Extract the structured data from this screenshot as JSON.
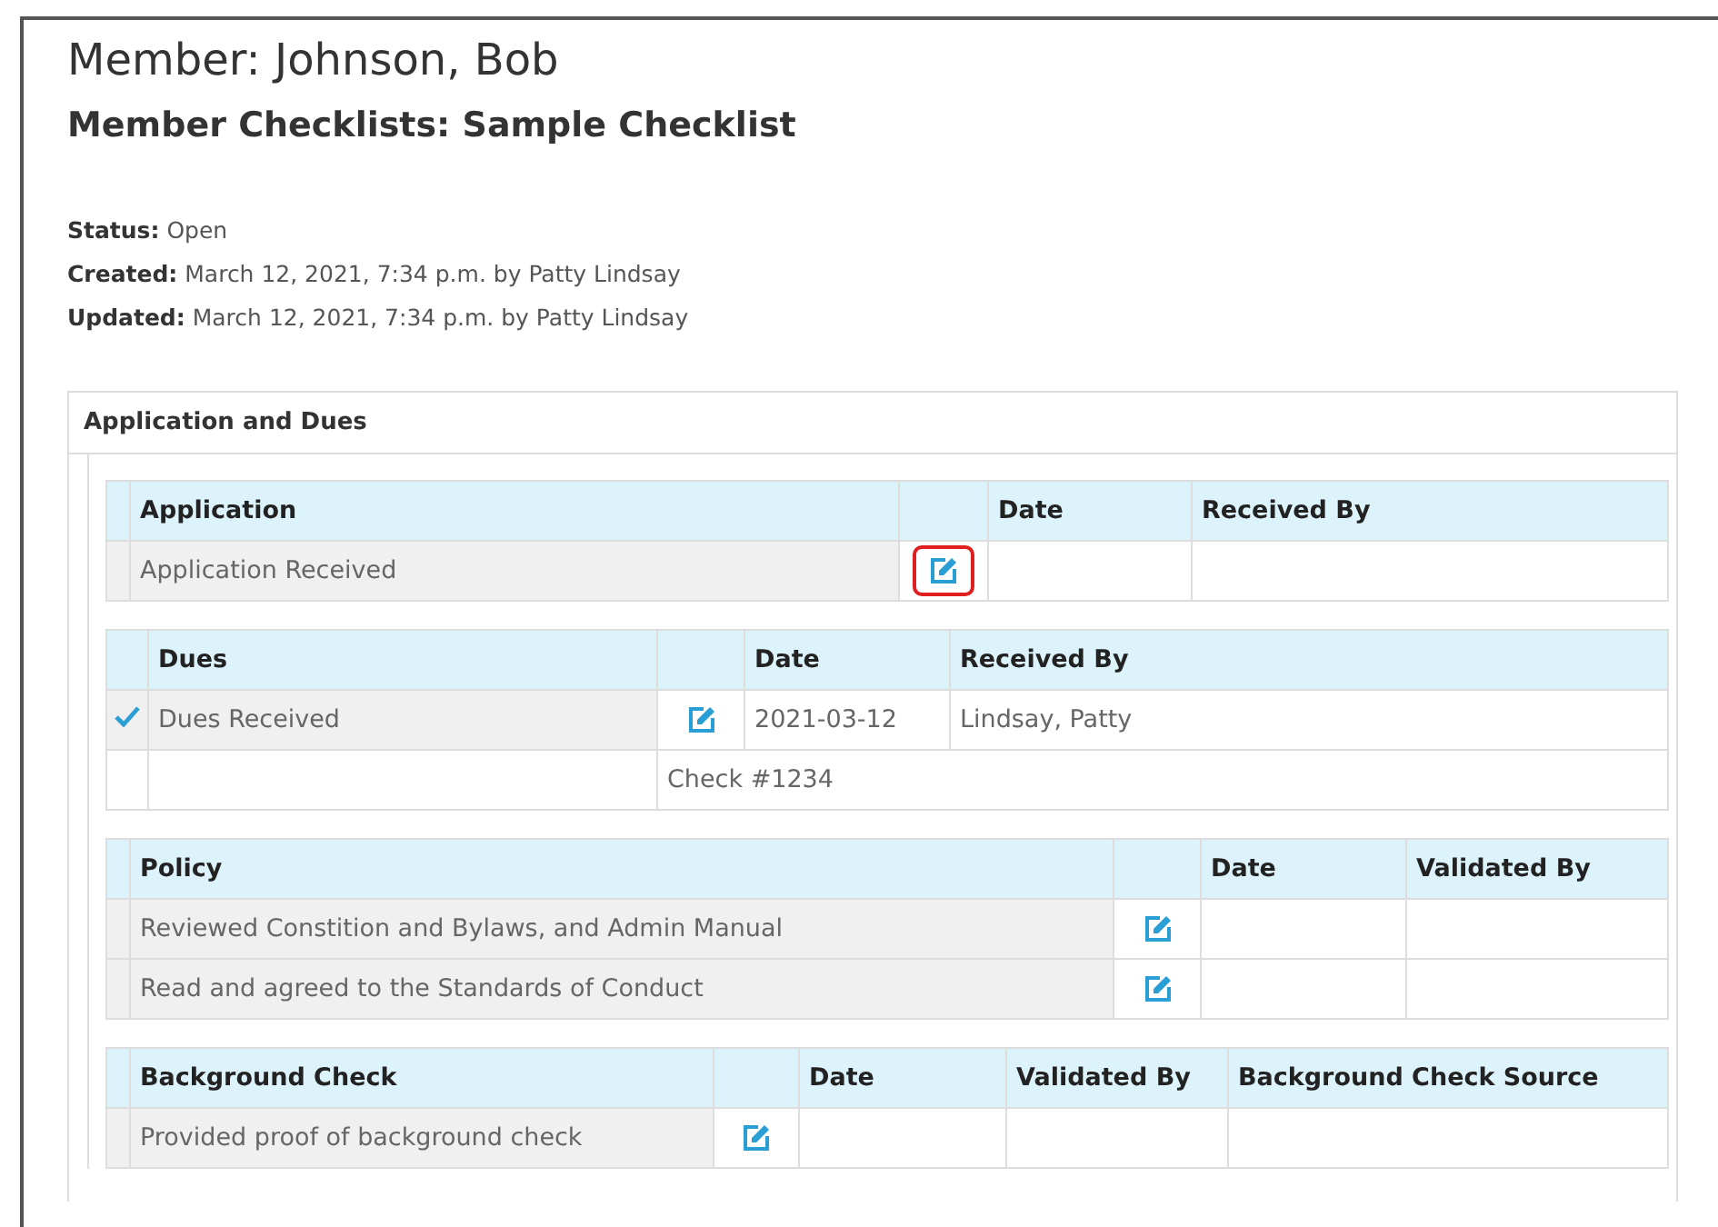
{
  "member_title": "Member: Johnson, Bob",
  "checklist_title": "Member Checklists: Sample Checklist",
  "details": [
    {
      "label": "Status:",
      "value": "Open"
    },
    {
      "label": "Created:",
      "value": "March 12, 2021, 7:34 p.m. by Patty Lindsay"
    },
    {
      "label": "Updated:",
      "value": "March 12, 2021, 7:34 p.m. by Patty Lindsay"
    }
  ],
  "section": {
    "title": "Application and Dues",
    "tables": [
      {
        "heading": "Application",
        "columns": [
          "Date",
          "Received By"
        ],
        "rows": [
          {
            "kind": "item",
            "label": "Application Received",
            "checked": false,
            "edit_highlighted": true,
            "cells": []
          }
        ]
      },
      {
        "heading": "Dues",
        "columns": [
          "Date",
          "Received By"
        ],
        "rows": [
          {
            "kind": "item",
            "label": "Dues Received",
            "checked": true,
            "edit_highlighted": false,
            "cells": [
              "2021-03-12",
              "Lindsay, Patty"
            ]
          },
          {
            "kind": "note",
            "text": "Check #1234"
          }
        ]
      },
      {
        "heading": "Policy",
        "columns": [
          "Date",
          "Validated By"
        ],
        "rows": [
          {
            "kind": "item",
            "label": "Reviewed Constition and Bylaws, and Admin Manual",
            "checked": false,
            "edit_highlighted": false,
            "cells": []
          },
          {
            "kind": "item",
            "label": "Read and agreed to the Standards of Conduct",
            "checked": false,
            "edit_highlighted": false,
            "cells": []
          }
        ]
      },
      {
        "heading": "Background Check",
        "columns": [
          "Date",
          "Validated By",
          "Background Check Source"
        ],
        "rows": [
          {
            "kind": "item",
            "label": "Provided proof of background check",
            "checked": false,
            "edit_highlighted": false,
            "cells": []
          }
        ]
      }
    ]
  }
}
